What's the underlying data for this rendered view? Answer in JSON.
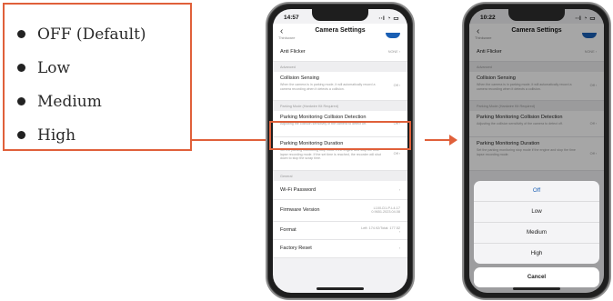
{
  "options_box": {
    "items": [
      "OFF (Default)",
      "Low",
      "Medium",
      "High"
    ]
  },
  "phone_left": {
    "time": "14:57",
    "status_icons": "∙∙l ◔ ▭",
    "back": "‹",
    "nav_sub": "Thinkware",
    "title": "Camera Settings",
    "rows": [
      {
        "type": "row",
        "label": "Anti Flicker",
        "value": "NONE ›",
        "h": 20
      },
      {
        "type": "section",
        "label": "Advanced"
      },
      {
        "type": "row",
        "label": "Collision Sensing",
        "desc": "When the camera is in parking mode, it will automatically record a camera recording when it detects a collision.",
        "value": "Off ›",
        "h": 32
      },
      {
        "type": "section",
        "label": "Parking Mode (Hardwire Kit Required)"
      },
      {
        "type": "row",
        "label": "Parking Monitoring Collision Detection",
        "desc": "Adjusting the collision sensitivity of the camera to detect off.",
        "value": "Off ›",
        "h": 29
      },
      {
        "type": "row",
        "label": "Parking Monitoring Duration",
        "desc": "Set the parking monitoring stop mode if the engine and stop the time lapse recording mode. If the set time is reached, the recorder will shut down to stop the scrap time.",
        "value": "Off ›",
        "h": 37
      },
      {
        "type": "section",
        "label": "General"
      },
      {
        "type": "row",
        "label": "Wi-Fi Password",
        "value": "›",
        "h": 21
      },
      {
        "type": "row",
        "label": "Firmware Version",
        "value": "L100-D1-P-L4-17 0.9651.2023.04.08",
        "h": 24
      },
      {
        "type": "row",
        "label": "Format",
        "value": "Left: 174.92/Total: 177.52 ›",
        "h": 20
      },
      {
        "type": "row",
        "label": "Factory Reset",
        "value": "›",
        "h": 20
      }
    ]
  },
  "phone_right": {
    "time": "10:22",
    "status_icons": "∙∙l ◔ ▭",
    "back": "‹",
    "nav_sub": "Thinkware",
    "title": "Camera Settings",
    "rows": [
      {
        "type": "row",
        "label": "Anti Flicker",
        "value": "NONE ›",
        "h": 20
      },
      {
        "type": "section",
        "label": "Advanced"
      },
      {
        "type": "row",
        "label": "Collision Sensing",
        "desc": "When the camera is in parking mode, it will automatically record a camera recording when it detects a collision.",
        "value": "Off ›",
        "h": 32
      },
      {
        "type": "section",
        "label": "Parking Mode (Hardwire Kit Required)"
      },
      {
        "type": "row",
        "label": "Parking Monitoring Collision Detection",
        "desc": "Adjusting the collision sensitivity of the camera to detect off.",
        "value": "Off ›",
        "h": 29
      },
      {
        "type": "row",
        "label": "Parking Monitoring Duration",
        "desc": "Set the parking monitoring stop mode if the engine and stop the time lapse recording mode.",
        "value": "Off ›",
        "h": 37
      }
    ],
    "sheet_options": [
      "Off",
      "Low",
      "Medium",
      "High"
    ],
    "cancel": "Cancel"
  },
  "colors": {
    "accent": "#e0603a",
    "ios_blue": "#1a5fb4"
  }
}
